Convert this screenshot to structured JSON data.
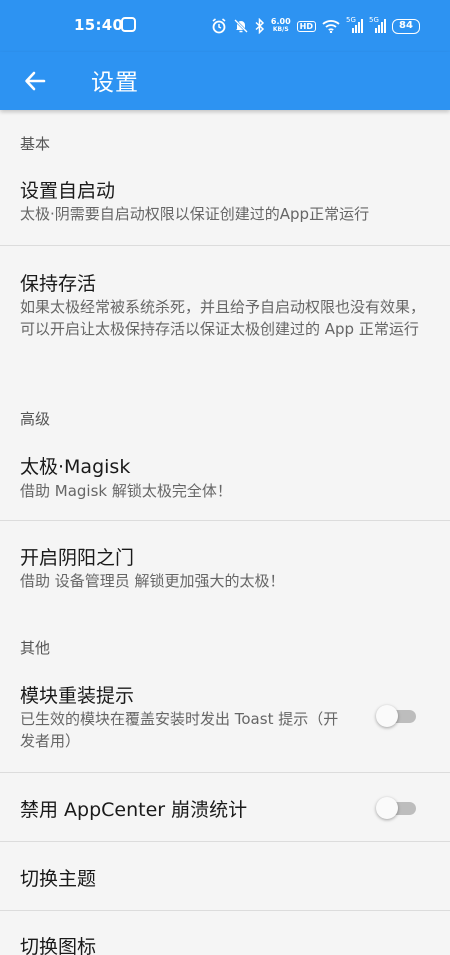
{
  "status_bar": {
    "time": "15:40",
    "net_speed_value": "6.00",
    "net_speed_unit": "KB/S",
    "hd_badge": "HD",
    "signal1_label": "5G",
    "signal2_label": "5G",
    "battery": "84"
  },
  "app_bar": {
    "title": "设置"
  },
  "sections": {
    "basic": "基本",
    "advanced": "高级",
    "other": "其他"
  },
  "items": {
    "autostart": {
      "title": "设置自启动",
      "subtitle": "太极·阴需要自启动权限以保证创建过的App正常运行"
    },
    "keep_alive": {
      "title": "保持存活",
      "subtitle": "如果太极经常被系统杀死，并且给予自启动权限也没有效果，可以开启让太极保持存活以保证太极创建过的 App 正常运行"
    },
    "magisk": {
      "title": "太极·Magisk",
      "subtitle": "借助 Magisk 解锁太极完全体！"
    },
    "yinyang": {
      "title": "开启阴阳之门",
      "subtitle": "借助 设备管理员 解锁更加强大的太极！"
    },
    "module_reinstall": {
      "title": "模块重装提示",
      "subtitle": "已生效的模块在覆盖安装时发出 Toast 提示（开发者用）",
      "enabled": false
    },
    "appcenter": {
      "title": "禁用 AppCenter 崩溃统计",
      "enabled": false
    },
    "theme": {
      "title": "切换主题"
    },
    "icon": {
      "title": "切换图标"
    }
  },
  "colors": {
    "primary": "#2d93f2",
    "background": "#f5f5f5",
    "divider": "#dcdcdc",
    "switch_off_track": "#bdbdbd"
  },
  "icons": {
    "back": "arrow-back-icon",
    "alarm": "alarm-icon",
    "mute": "bell-off-icon",
    "bluetooth": "bluetooth-icon",
    "wifi": "wifi-icon",
    "signal": "signal-icon"
  }
}
